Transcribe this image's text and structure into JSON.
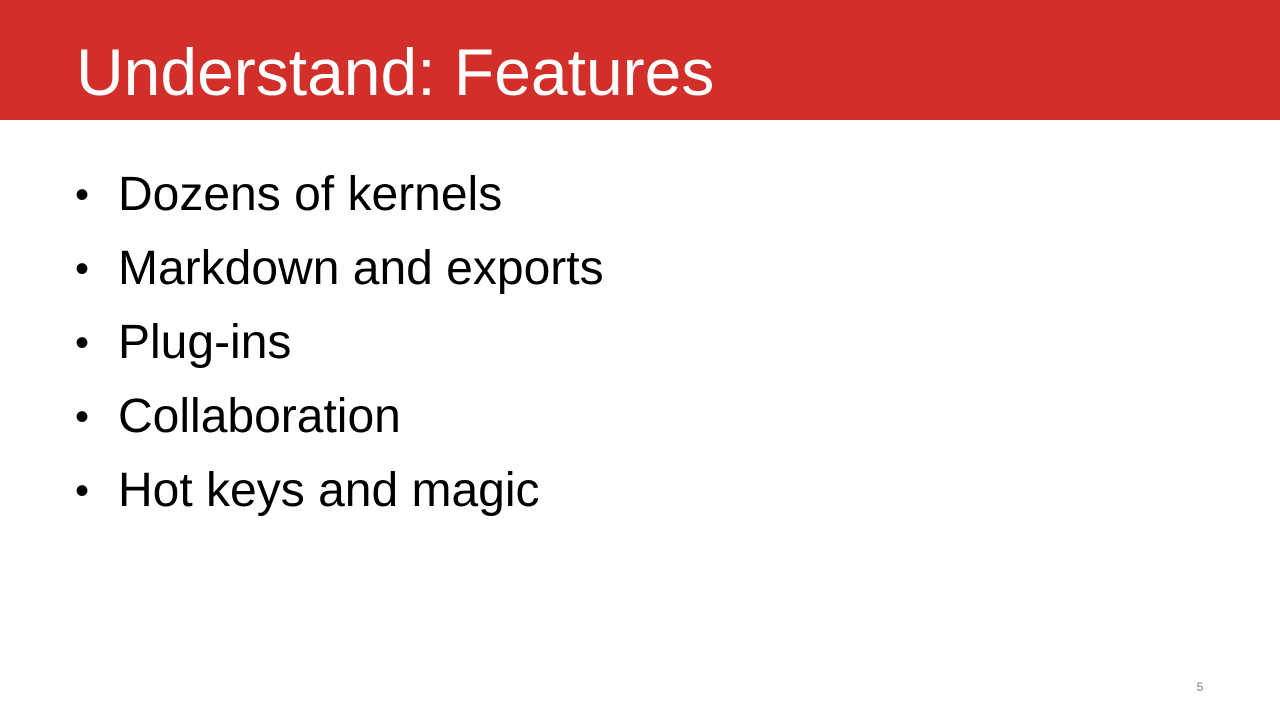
{
  "slide": {
    "title": "Understand: Features",
    "bullets": [
      "Dozens of kernels",
      "Markdown and exports",
      "Plug-ins",
      "Collaboration",
      "Hot keys and magic"
    ],
    "bullet_symbol": "•",
    "page_number": "5"
  },
  "colors": {
    "title_bar": "#d22f2a",
    "title_text": "#ffffff",
    "body_text": "#000000",
    "page_number": "#7f7f7f"
  }
}
